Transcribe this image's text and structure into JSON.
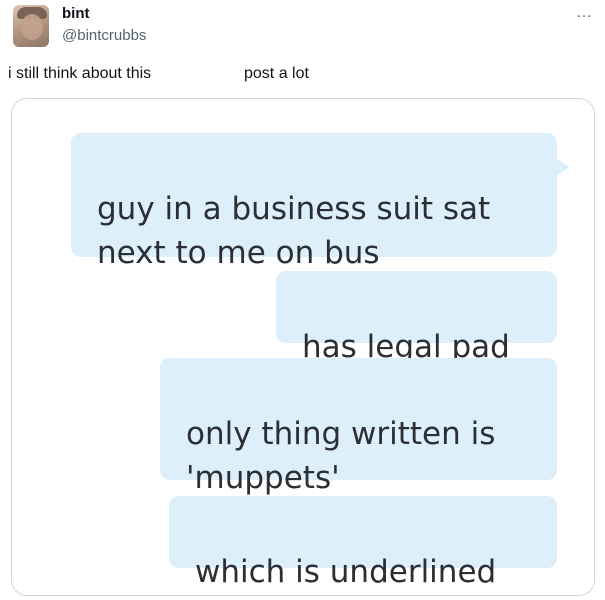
{
  "post": {
    "display_name": "bint",
    "handle": "@bintcrubbs",
    "more_icon": "…",
    "text_left": "i still think about this",
    "text_right": "post a lot"
  },
  "image_messages": [
    "guy in a business suit sat\nnext to me on bus",
    "has legal pad",
    "only thing written is\n'muppets'",
    "which is underlined"
  ],
  "colors": {
    "bubble": "#ddeffb",
    "card_border": "#cfd9de",
    "handle": "#536471"
  }
}
